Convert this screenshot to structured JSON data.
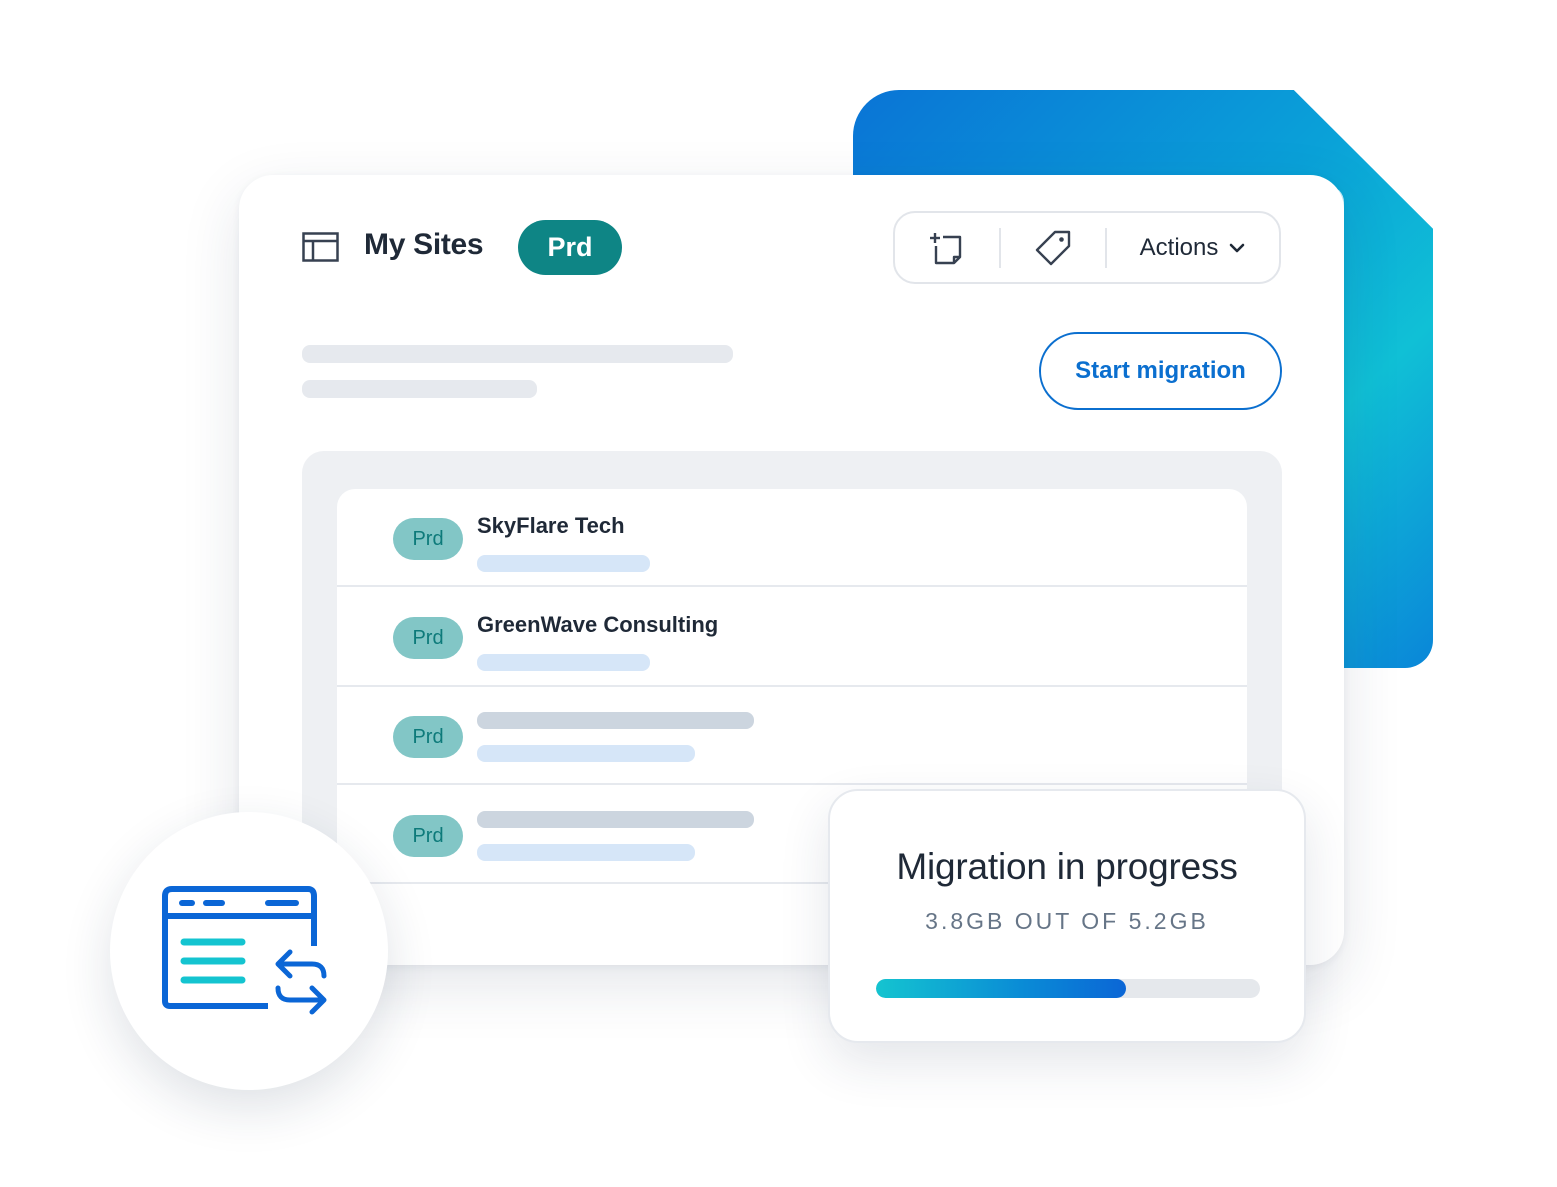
{
  "header": {
    "title": "My Sites",
    "env_badge": "Prd",
    "toolbar": {
      "new_site_icon": "add-page-icon",
      "tag_icon": "tag-icon",
      "actions_label": "Actions"
    }
  },
  "start_migration_label": "Start migration",
  "sites": [
    {
      "env": "Prd",
      "name": "SkyFlare Tech"
    },
    {
      "env": "Prd",
      "name": "GreenWave Consulting"
    },
    {
      "env": "Prd",
      "name": ""
    },
    {
      "env": "Prd",
      "name": ""
    }
  ],
  "migration": {
    "title": "Migration in progress",
    "status": "3.8GB OUT OF 5.2GB",
    "progress_fraction": 0.65
  },
  "colors": {
    "brand_blue": "#0b6fcf",
    "teal_badge": "#0e8585",
    "badge_light": "#82c6c6"
  },
  "icons": {
    "window": "site-window-icon",
    "migration": "browser-sync-icon",
    "dropdown": "chevron-down-icon"
  }
}
